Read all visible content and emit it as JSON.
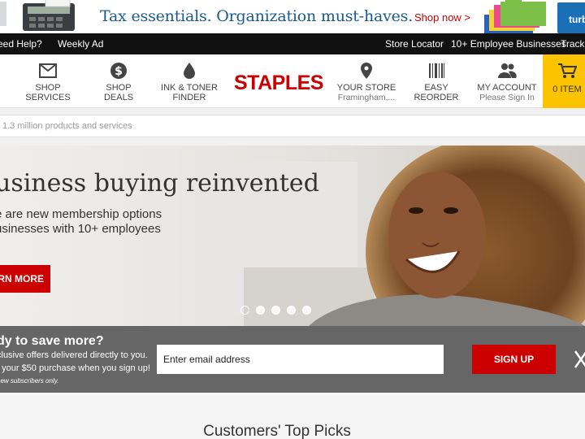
{
  "promo": {
    "headline": "Tax essentials. Organization must-haves.",
    "cta": "Shop now >",
    "turbo_text": "turb"
  },
  "utilbar": {
    "need_help": "eed Help?",
    "weekly_ad": "Weekly Ad",
    "store_locator": "Store Locator",
    "employee_businesses": "10+ Employee Businesses",
    "track": "Track"
  },
  "nav": {
    "shop_services_1": "SHOP",
    "shop_services_2": "SERVICES",
    "shop_deals": "SHOP DEALS",
    "ink_1": "INK & TONER",
    "ink_2": "FINDER",
    "logo": "STAPLES",
    "store_1": "YOUR STORE",
    "store_2": "Framingham,...",
    "reorder_1": "EASY",
    "reorder_2": "REORDER",
    "account_1": "MY ACCOUNT",
    "account_2": "Please Sign In",
    "cart": "0 ITEM"
  },
  "search": {
    "placeholder": "1.3 million products and services"
  },
  "hero": {
    "title": "usiness buying reinvented",
    "sub1": "e are new membership options",
    "sub2": "usinesses with 10+ employees",
    "button": "RN MORE",
    "slides": 5,
    "active_slide": 1
  },
  "signup": {
    "heading": "dy to save more?",
    "line1": "clusive offers delivered directly to you.",
    "line2": "f your $50 purchase when you sign up!",
    "line3": "new subscribers only.",
    "email_placeholder": "Enter email address",
    "button": "SIGN UP"
  },
  "picks": {
    "title": "Customers' Top Picks"
  },
  "colors": {
    "brand_red": "#cc0000",
    "cart_yellow": "#fcc400",
    "promo_blue": "#1a5b8f",
    "util_black": "#111111",
    "signup_gray": "#666666"
  }
}
